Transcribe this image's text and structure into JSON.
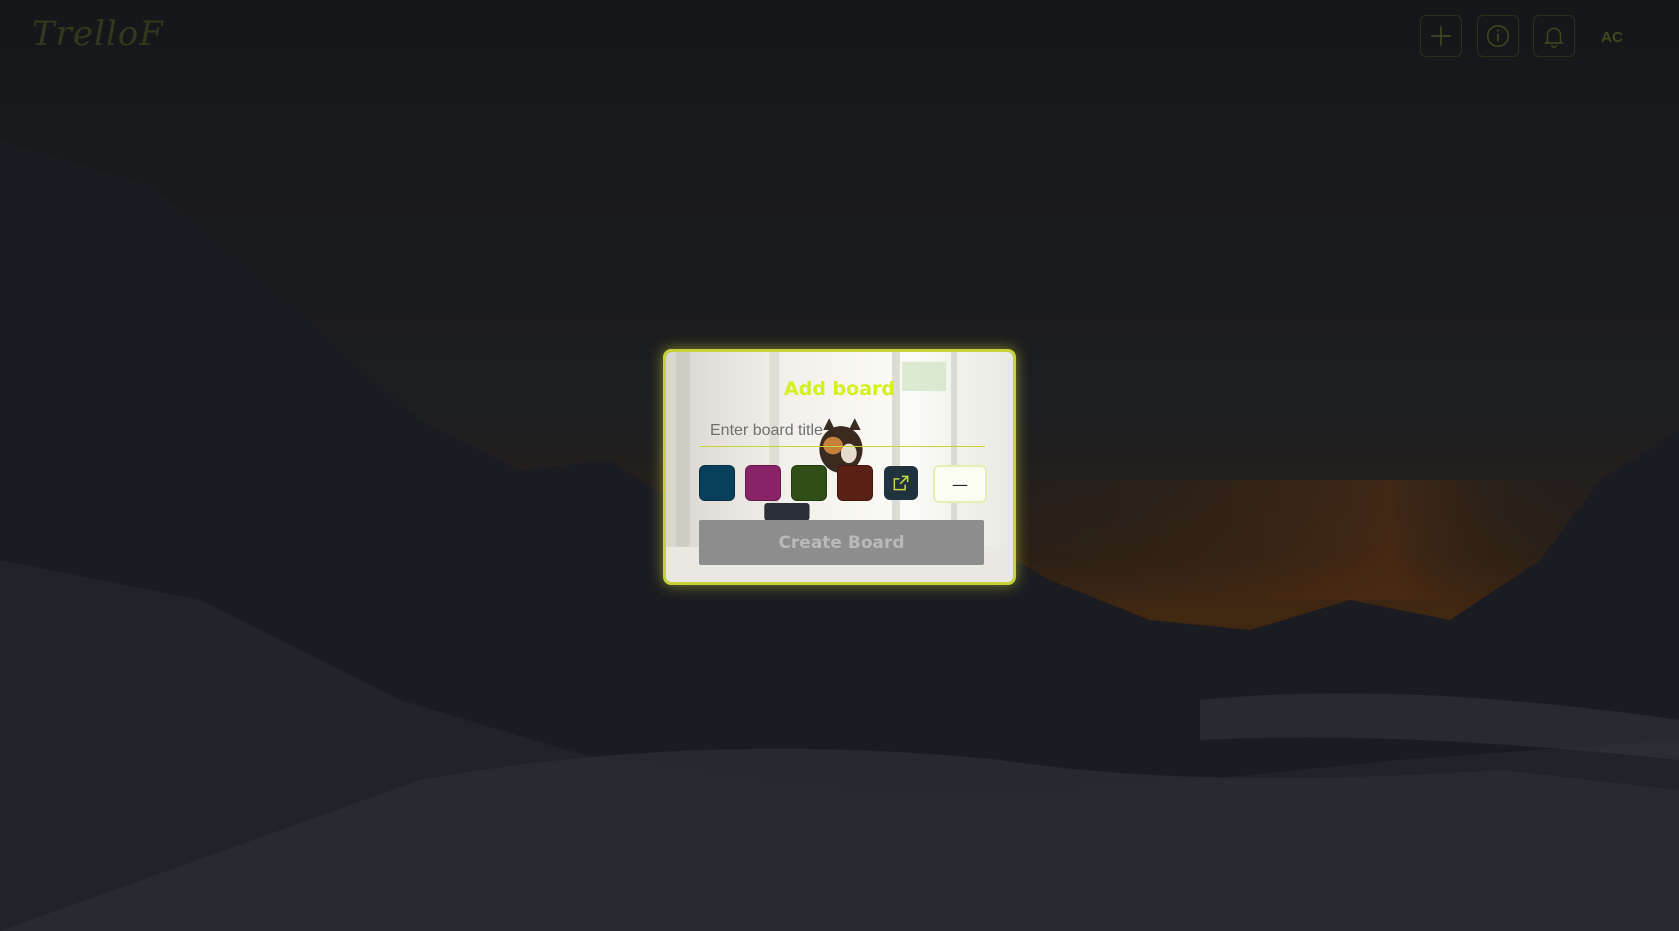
{
  "app": {
    "logo_text": "TrelloF"
  },
  "topbar": {
    "add_icon": "plus-icon",
    "info_icon": "info-icon",
    "bell_icon": "bell-icon",
    "avatar_initials": "AC"
  },
  "modal": {
    "title": "Add board",
    "title_input": {
      "value": "",
      "placeholder": "Enter board title"
    },
    "color_options": [
      {
        "name": "blue",
        "color": "#0a3f5c"
      },
      {
        "name": "magenta",
        "color": "#8a2268"
      },
      {
        "name": "green",
        "color": "#2f4f16"
      },
      {
        "name": "brown",
        "color": "#5a1f15"
      }
    ],
    "custom_color_icon": "external-link-icon",
    "no_background_label": "—",
    "create_button_label": "Create Board"
  },
  "colors": {
    "accent": "#d4f01e",
    "modal_border": "#c9d13a",
    "disabled_button": "#8d8d8d"
  }
}
